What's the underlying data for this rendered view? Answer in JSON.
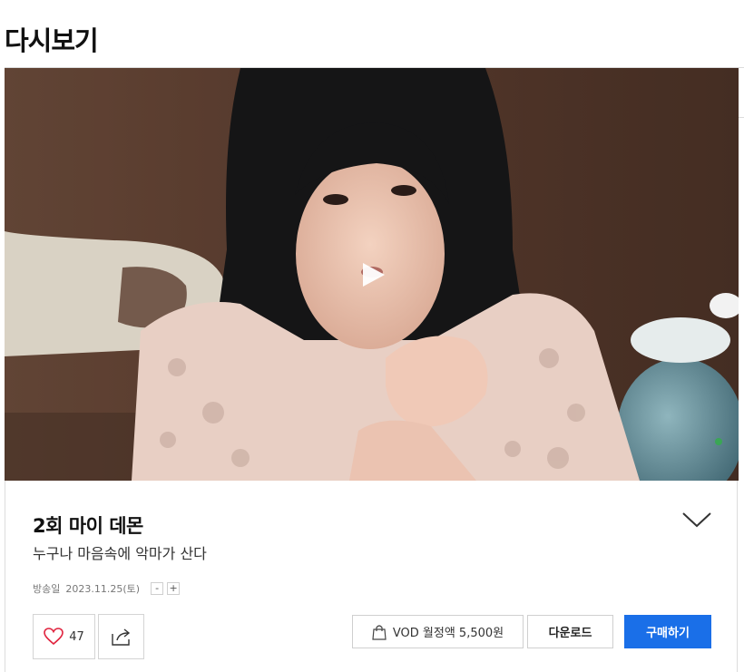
{
  "page": {
    "title": "다시보기"
  },
  "video": {
    "thumbnail_icon": "drama-scene-thumbnail",
    "play_icon": "play-icon"
  },
  "episode": {
    "title": "2회 마이 데몬",
    "subtitle": "누구나 마음속에 악마가 산다",
    "air_label": "방송일",
    "air_date": "2023.11.25(토)",
    "font_decrease": "-",
    "font_increase": "+",
    "expand_icon": "chevron-down-icon"
  },
  "actions": {
    "like_icon": "heart-icon",
    "like_count": "47",
    "share_icon": "share-icon",
    "vod_icon": "shopping-bag-icon",
    "vod_label": "VOD 월정액 5,500원",
    "download_label": "다운로드",
    "buy_label": "구매하기"
  },
  "colors": {
    "accent": "#1a6fe8",
    "heart": "#e0233e"
  }
}
